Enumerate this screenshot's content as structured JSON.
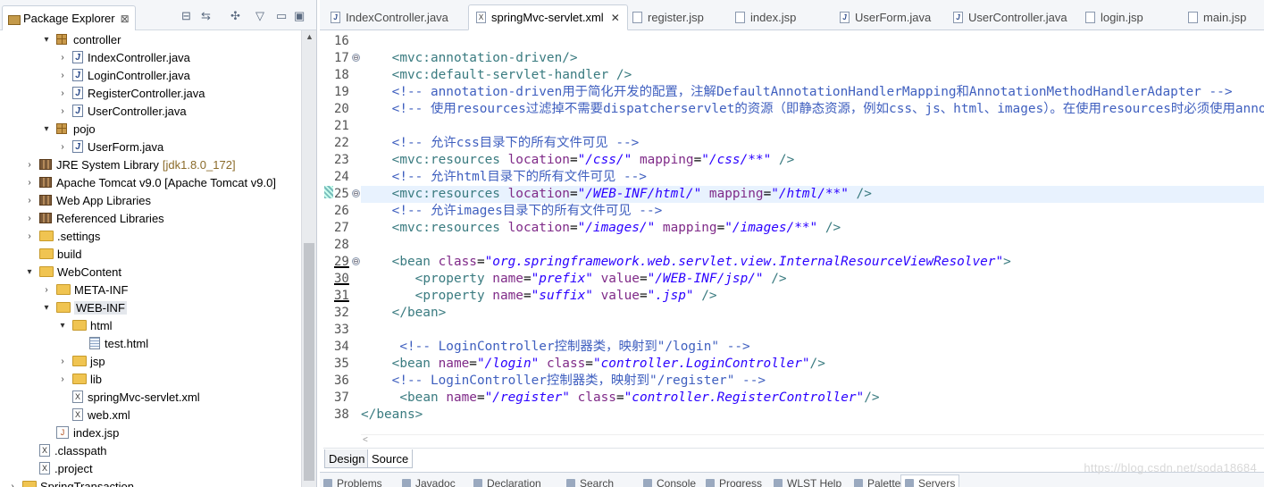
{
  "explorer": {
    "title": "Package Explorer",
    "close_glyph": "⊠",
    "toolbar": {
      "collapse": "⊟",
      "link": "⇆",
      "sync": "✣",
      "menu": "▽",
      "minimize": "▭",
      "maximize": "▣"
    },
    "tree": [
      {
        "arrow": "▾",
        "icon": "pkg",
        "label": "controller",
        "indent": 46
      },
      {
        "arrow": "›",
        "icon": "java",
        "label": "IndexController.java",
        "indent": 64
      },
      {
        "arrow": "›",
        "icon": "java",
        "label": "LoginController.java",
        "indent": 64
      },
      {
        "arrow": "›",
        "icon": "java",
        "label": "RegisterController.java",
        "indent": 64
      },
      {
        "arrow": "›",
        "icon": "java",
        "label": "UserController.java",
        "indent": 64
      },
      {
        "arrow": "▾",
        "icon": "pkg",
        "label": "pojo",
        "indent": 46
      },
      {
        "arrow": "›",
        "icon": "java",
        "label": "UserForm.java",
        "indent": 64
      },
      {
        "arrow": "›",
        "icon": "lib",
        "label": "JRE System Library",
        "decor": "[jdk1.8.0_172]",
        "indent": 27
      },
      {
        "arrow": "›",
        "icon": "lib",
        "label": "Apache Tomcat v9.0 [Apache Tomcat v9.0]",
        "indent": 27
      },
      {
        "arrow": "›",
        "icon": "lib",
        "label": "Web App Libraries",
        "indent": 27
      },
      {
        "arrow": "›",
        "icon": "lib",
        "label": "Referenced Libraries",
        "indent": 27
      },
      {
        "arrow": "›",
        "icon": "folder",
        "label": ".settings",
        "indent": 27
      },
      {
        "arrow": "",
        "icon": "folder",
        "label": "build",
        "indent": 27
      },
      {
        "arrow": "▾",
        "icon": "folder",
        "label": "WebContent",
        "indent": 27
      },
      {
        "arrow": "›",
        "icon": "folder",
        "label": "META-INF",
        "indent": 46
      },
      {
        "arrow": "▾",
        "icon": "folder",
        "label": "WEB-INF",
        "indent": 46,
        "selected": true
      },
      {
        "arrow": "▾",
        "icon": "folder",
        "label": "html",
        "indent": 64
      },
      {
        "arrow": "",
        "icon": "html",
        "label": "test.html",
        "indent": 83
      },
      {
        "arrow": "›",
        "icon": "folder",
        "label": "jsp",
        "indent": 64
      },
      {
        "arrow": "›",
        "icon": "folder",
        "label": "lib",
        "indent": 64
      },
      {
        "arrow": "",
        "icon": "xml",
        "label": "springMvc-servlet.xml",
        "indent": 64
      },
      {
        "arrow": "",
        "icon": "xml",
        "label": "web.xml",
        "indent": 64
      },
      {
        "arrow": "",
        "icon": "jsp",
        "label": "index.jsp",
        "indent": 46
      },
      {
        "arrow": "",
        "icon": "xml",
        "label": ".classpath",
        "indent": 27
      },
      {
        "arrow": "",
        "icon": "xml",
        "label": ".project",
        "indent": 27
      },
      {
        "arrow": "›",
        "icon": "proj",
        "label": "SpringTransaction",
        "indent": 8
      }
    ]
  },
  "editor": {
    "tabs": [
      {
        "label": "IndexController.java",
        "kind": "java"
      },
      {
        "label": "springMvc-servlet.xml",
        "kind": "xml",
        "active": true
      },
      {
        "label": "register.jsp",
        "kind": "jsp"
      },
      {
        "label": "index.jsp",
        "kind": "jsp"
      },
      {
        "label": "UserForm.java",
        "kind": "java"
      },
      {
        "label": "UserController.java",
        "kind": "java"
      },
      {
        "label": "login.jsp",
        "kind": "jsp"
      },
      {
        "label": "main.jsp",
        "kind": "jsp"
      }
    ],
    "tab_close_glyph": "✕",
    "lines": [
      {
        "n": "16",
        "segs": []
      },
      {
        "n": "17",
        "fold": true,
        "segs": [
          [
            "plain",
            "    "
          ],
          [
            "tag",
            "<mvc:annotation-driven/>"
          ]
        ]
      },
      {
        "n": "18",
        "segs": [
          [
            "plain",
            "    "
          ],
          [
            "tag",
            "<mvc:default-servlet-handler />"
          ]
        ]
      },
      {
        "n": "19",
        "segs": [
          [
            "plain",
            "    "
          ],
          [
            "cmt",
            "<!-- annotation-driven用于简化开发的配置，注解DefaultAnnotationHandlerMapping和AnnotationMethodHandlerAdapter -->"
          ]
        ]
      },
      {
        "n": "20",
        "segs": [
          [
            "plain",
            "    "
          ],
          [
            "cmt",
            "<!-- 使用resources过滤掉不需要dispatcherservlet的资源（即静态资源，例如css、js、html、images）。在使用resources时必须使用annotation"
          ]
        ]
      },
      {
        "n": "21",
        "segs": []
      },
      {
        "n": "22",
        "segs": [
          [
            "plain",
            "    "
          ],
          [
            "cmt",
            "<!-- 允许css目录下的所有文件可见 -->"
          ]
        ]
      },
      {
        "n": "23",
        "segs": [
          [
            "plain",
            "    "
          ],
          [
            "tag",
            "<mvc:resources "
          ],
          [
            "attr",
            "location"
          ],
          [
            "plain",
            "="
          ],
          [
            "val",
            "\"/css/\""
          ],
          [
            "plain",
            " "
          ],
          [
            "attr",
            "mapping"
          ],
          [
            "plain",
            "="
          ],
          [
            "val",
            "\"/css/**\""
          ],
          [
            "tag",
            " />"
          ]
        ]
      },
      {
        "n": "24",
        "segs": [
          [
            "plain",
            "    "
          ],
          [
            "cmt",
            "<!-- 允许html目录下的所有文件可见 -->"
          ]
        ]
      },
      {
        "n": "25",
        "fold": true,
        "current": true,
        "segs": [
          [
            "plain",
            "    "
          ],
          [
            "tag",
            "<mvc:resources "
          ],
          [
            "attr",
            "location"
          ],
          [
            "plain",
            "="
          ],
          [
            "val",
            "\"/WEB-INF/html/\""
          ],
          [
            "plain",
            " "
          ],
          [
            "attr",
            "mapping"
          ],
          [
            "plain",
            "="
          ],
          [
            "val",
            "\"/html/**\""
          ],
          [
            "tag",
            " />"
          ]
        ]
      },
      {
        "n": "26",
        "segs": [
          [
            "plain",
            "    "
          ],
          [
            "cmt",
            "<!-- 允许images目录下的所有文件可见 -->"
          ]
        ]
      },
      {
        "n": "27",
        "segs": [
          [
            "plain",
            "    "
          ],
          [
            "tag",
            "<mvc:resources "
          ],
          [
            "attr",
            "location"
          ],
          [
            "plain",
            "="
          ],
          [
            "val",
            "\"/images/\""
          ],
          [
            "plain",
            " "
          ],
          [
            "attr",
            "mapping"
          ],
          [
            "plain",
            "="
          ],
          [
            "val",
            "\"/images/**\""
          ],
          [
            "tag",
            " />"
          ]
        ]
      },
      {
        "n": "28",
        "segs": []
      },
      {
        "n": "29",
        "fold": true,
        "ul": true,
        "segs": [
          [
            "plain",
            "    "
          ],
          [
            "tag",
            "<bean "
          ],
          [
            "attr",
            "class"
          ],
          [
            "plain",
            "="
          ],
          [
            "val",
            "\"org.springframework.web.servlet.view.InternalResourceViewResolver\""
          ],
          [
            "tag",
            ">"
          ]
        ]
      },
      {
        "n": "30",
        "ul": true,
        "segs": [
          [
            "plain",
            "       "
          ],
          [
            "tag",
            "<property "
          ],
          [
            "attr",
            "name"
          ],
          [
            "plain",
            "="
          ],
          [
            "val",
            "\"prefix\""
          ],
          [
            "plain",
            " "
          ],
          [
            "attr",
            "value"
          ],
          [
            "plain",
            "="
          ],
          [
            "val",
            "\"/WEB-INF/jsp/\""
          ],
          [
            "tag",
            " />"
          ]
        ]
      },
      {
        "n": "31",
        "ul": true,
        "segs": [
          [
            "plain",
            "       "
          ],
          [
            "tag",
            "<property "
          ],
          [
            "attr",
            "name"
          ],
          [
            "plain",
            "="
          ],
          [
            "val",
            "\"suffix\""
          ],
          [
            "plain",
            " "
          ],
          [
            "attr",
            "value"
          ],
          [
            "plain",
            "="
          ],
          [
            "val",
            "\".jsp\""
          ],
          [
            "tag",
            " />"
          ]
        ]
      },
      {
        "n": "32",
        "segs": [
          [
            "plain",
            "    "
          ],
          [
            "tag",
            "</bean>"
          ]
        ]
      },
      {
        "n": "33",
        "segs": []
      },
      {
        "n": "34",
        "segs": [
          [
            "plain",
            "     "
          ],
          [
            "cmt",
            "<!-- LoginController控制器类，映射到\"/login\" -->"
          ]
        ]
      },
      {
        "n": "35",
        "segs": [
          [
            "plain",
            "    "
          ],
          [
            "tag",
            "<bean "
          ],
          [
            "attr",
            "name"
          ],
          [
            "plain",
            "="
          ],
          [
            "val",
            "\"/login\""
          ],
          [
            "plain",
            " "
          ],
          [
            "attr",
            "class"
          ],
          [
            "plain",
            "="
          ],
          [
            "val",
            "\"controller.LoginController\""
          ],
          [
            "tag",
            "/>"
          ]
        ]
      },
      {
        "n": "36",
        "segs": [
          [
            "plain",
            "    "
          ],
          [
            "cmt",
            "<!-- LoginController控制器类，映射到\"/register\" -->"
          ]
        ]
      },
      {
        "n": "37",
        "segs": [
          [
            "plain",
            "     "
          ],
          [
            "tag",
            "<bean "
          ],
          [
            "attr",
            "name"
          ],
          [
            "plain",
            "="
          ],
          [
            "val",
            "\"/register\""
          ],
          [
            "plain",
            " "
          ],
          [
            "attr",
            "class"
          ],
          [
            "plain",
            "="
          ],
          [
            "val",
            "\"controller.RegisterController\""
          ],
          [
            "tag",
            "/>"
          ]
        ]
      },
      {
        "n": "38",
        "segs": [
          [
            "tag",
            "</beans>"
          ]
        ]
      }
    ],
    "bottom_tabs": [
      {
        "label": "Design"
      },
      {
        "label": "Source",
        "active": true
      }
    ],
    "hscroll_left": "<"
  },
  "views": [
    {
      "label": "Problems"
    },
    {
      "label": "Javadoc"
    },
    {
      "label": "Declaration"
    },
    {
      "label": "Search"
    },
    {
      "label": "Console"
    },
    {
      "label": "Progress"
    },
    {
      "label": "WLST Help"
    },
    {
      "label": "Palette"
    },
    {
      "label": "Servers",
      "active": true
    }
  ],
  "watermark": "https://blog.csdn.net/soda18684"
}
